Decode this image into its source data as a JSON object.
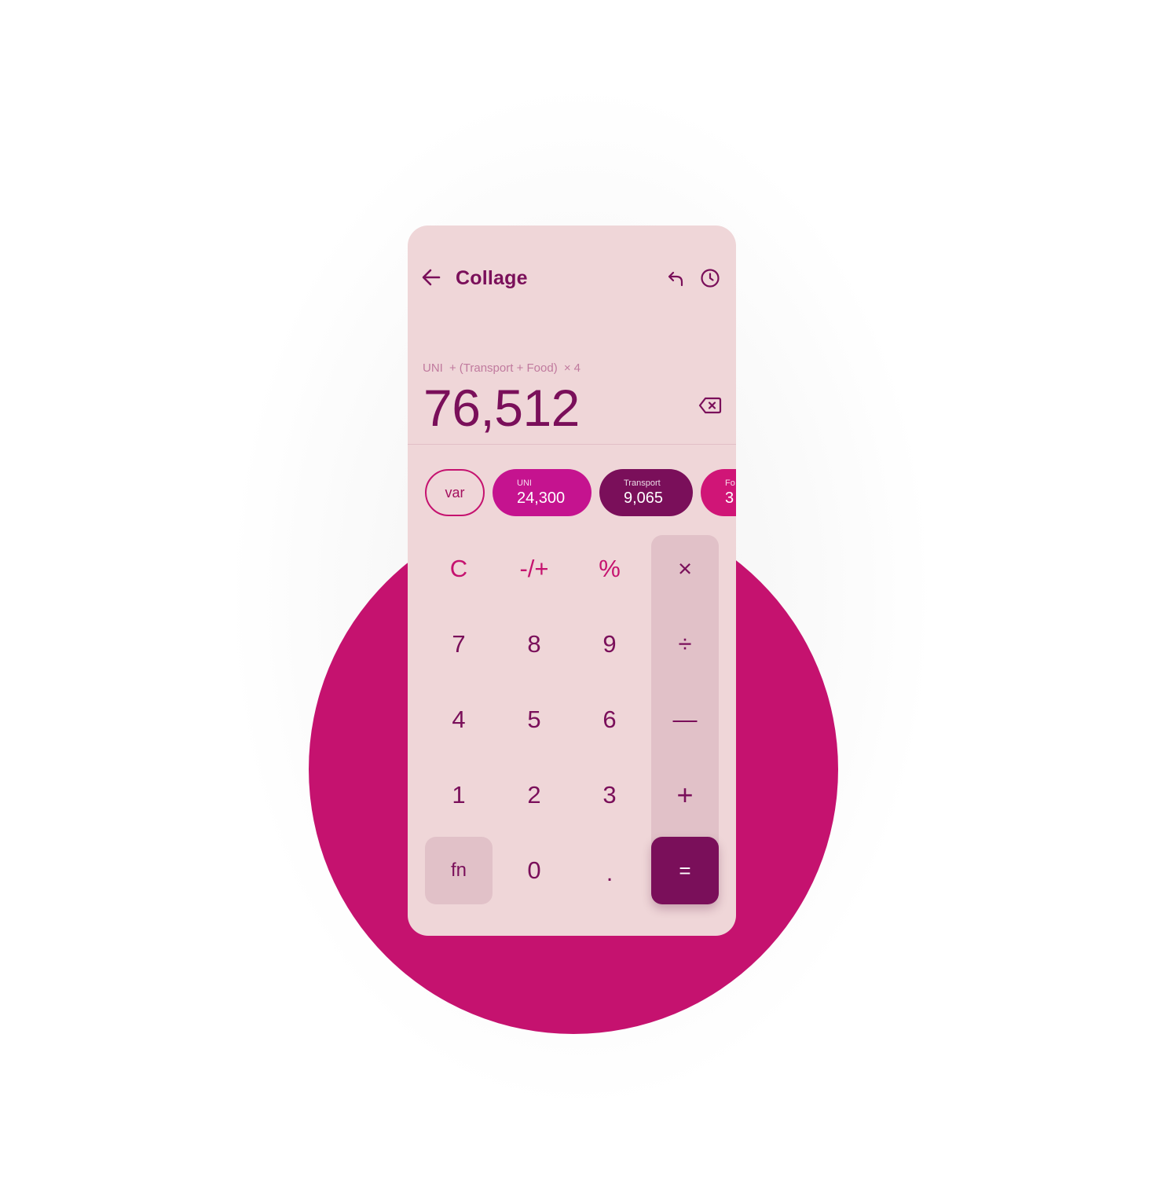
{
  "header": {
    "title": "Collage",
    "back_icon": "arrow-left-icon",
    "undo_icon": "undo-icon",
    "history_icon": "clock-icon"
  },
  "display": {
    "expression": {
      "var1": "UNI",
      "op1": "+",
      "group": "(Transport + Food)",
      "op2": "×",
      "factor": "4"
    },
    "result": "76,512",
    "backspace_icon": "backspace-icon"
  },
  "variables": {
    "var_button": "var",
    "chips": [
      {
        "name": "UNI",
        "value": "24,300",
        "color": "#c5138f"
      },
      {
        "name": "Transport",
        "value": "9,065",
        "color": "#7a0f5a"
      },
      {
        "name": "Fo",
        "value": "3",
        "color": "#d01577"
      }
    ]
  },
  "keypad": {
    "clear": "C",
    "negate": "-/+",
    "percent": "%",
    "multiply": "×",
    "seven": "7",
    "eight": "8",
    "nine": "9",
    "divide": "÷",
    "four": "4",
    "five": "5",
    "six": "6",
    "minus": "—",
    "one": "1",
    "two": "2",
    "three": "3",
    "plus": "+",
    "fn": "fn",
    "zero": "0",
    "dot": ".",
    "equals": "="
  },
  "colors": {
    "accent": "#c5126f",
    "dark": "#7a0f5a",
    "panel": "#efd6d8",
    "operator_column": "#e1c1c8"
  }
}
